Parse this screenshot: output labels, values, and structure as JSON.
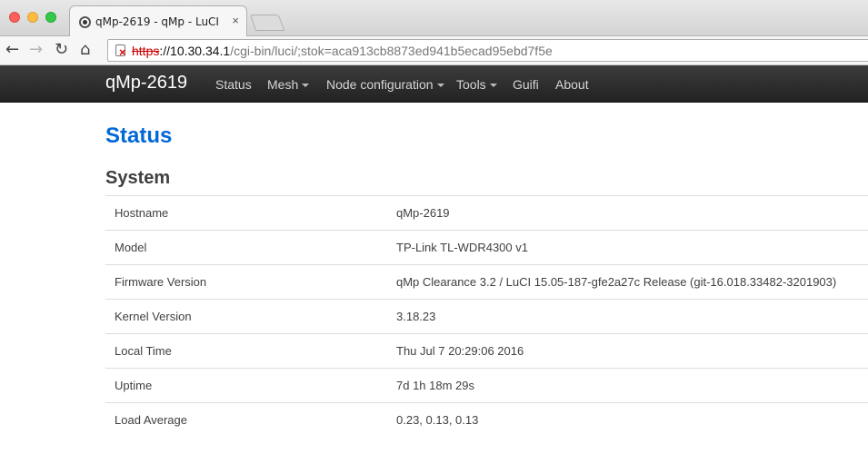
{
  "browser": {
    "tab_title": "qMp-2619 - qMp - LuCI",
    "url_scheme": "https",
    "url_host": "://10.30.34.1",
    "url_path": "/cgi-bin/luci/;stok=aca913cb8873ed941b5ecad95ebd7f5e"
  },
  "navbar": {
    "brand": "qMp-2619",
    "items": [
      {
        "label": "Status",
        "dropdown": false
      },
      {
        "label": "Mesh",
        "dropdown": true
      },
      {
        "label": "Node configuration",
        "dropdown": true
      },
      {
        "label": "Tools",
        "dropdown": true
      },
      {
        "label": "Guifi",
        "dropdown": false
      },
      {
        "label": "About",
        "dropdown": false
      }
    ]
  },
  "page": {
    "title": "Status",
    "section": "System",
    "rows": [
      {
        "key": "Hostname",
        "value": "qMp-2619"
      },
      {
        "key": "Model",
        "value": "TP-Link TL-WDR4300 v1"
      },
      {
        "key": "Firmware Version",
        "value": "qMp Clearance 3.2 / LuCI 15.05-187-gfe2a27c Release (git-16.018.33482-3201903)"
      },
      {
        "key": "Kernel Version",
        "value": "3.18.23"
      },
      {
        "key": "Local Time",
        "value": "Thu Jul 7 20:29:06 2016"
      },
      {
        "key": "Uptime",
        "value": "7d 1h 18m 29s"
      },
      {
        "key": "Load Average",
        "value": "0.23, 0.13, 0.13"
      }
    ]
  },
  "colors": {
    "title": "#0069d6",
    "navbar": "#222222"
  }
}
